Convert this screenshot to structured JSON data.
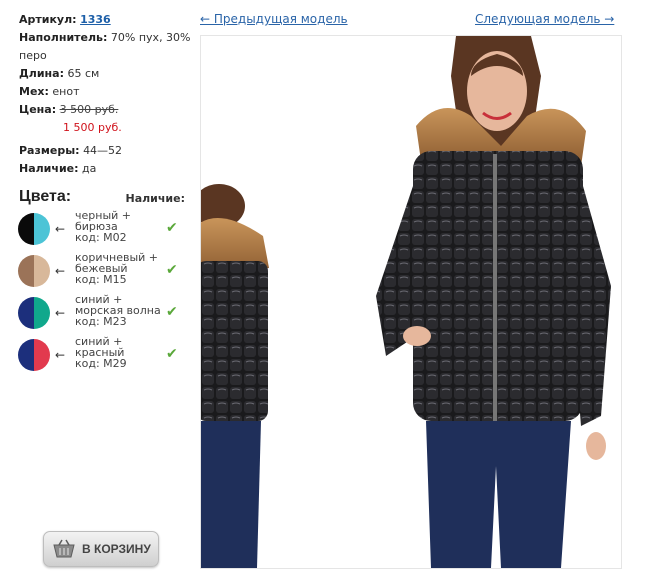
{
  "info": {
    "article_label": "Артикул:",
    "article_value": "1336",
    "filler_label": "Наполнитель:",
    "filler_value": "70% пух, 30% перо",
    "length_label": "Длина:",
    "length_value": "65 см",
    "fur_label": "Мех:",
    "fur_value": "енот",
    "price_label": "Цена:",
    "old_price": "3 500 руб.",
    "new_price": "1 500 руб.",
    "sizes_label": "Размеры:",
    "sizes_value": "44—52",
    "stock_label": "Наличие:",
    "stock_value": "да"
  },
  "colors": {
    "title": "Цвета:",
    "availability_title": "Наличие:",
    "items": [
      {
        "line1": "черный +",
        "line2": "бирюза",
        "code": "код: M02",
        "c1": "#0a0a0a",
        "c2": "#4cc4d6"
      },
      {
        "line1": "коричневый +",
        "line2": "бежевый",
        "code": "код: M15",
        "c1": "#9b7358",
        "c2": "#d8b89a"
      },
      {
        "line1": "синий +",
        "line2": "морская волна",
        "code": "код: M23",
        "c1": "#1c2f7c",
        "c2": "#10a88c"
      },
      {
        "line1": "синий +",
        "line2": "красный",
        "code": "код: M29",
        "c1": "#1c2f7c",
        "c2": "#e23a4e"
      }
    ]
  },
  "cart": {
    "label": "В КОРЗИНУ"
  },
  "nav": {
    "prev": "← Предыдущая модель",
    "next": "Следующая модель →"
  },
  "icons": {
    "arrow": "arrow-left-icon",
    "check": "check-icon",
    "cart": "basket-icon"
  }
}
